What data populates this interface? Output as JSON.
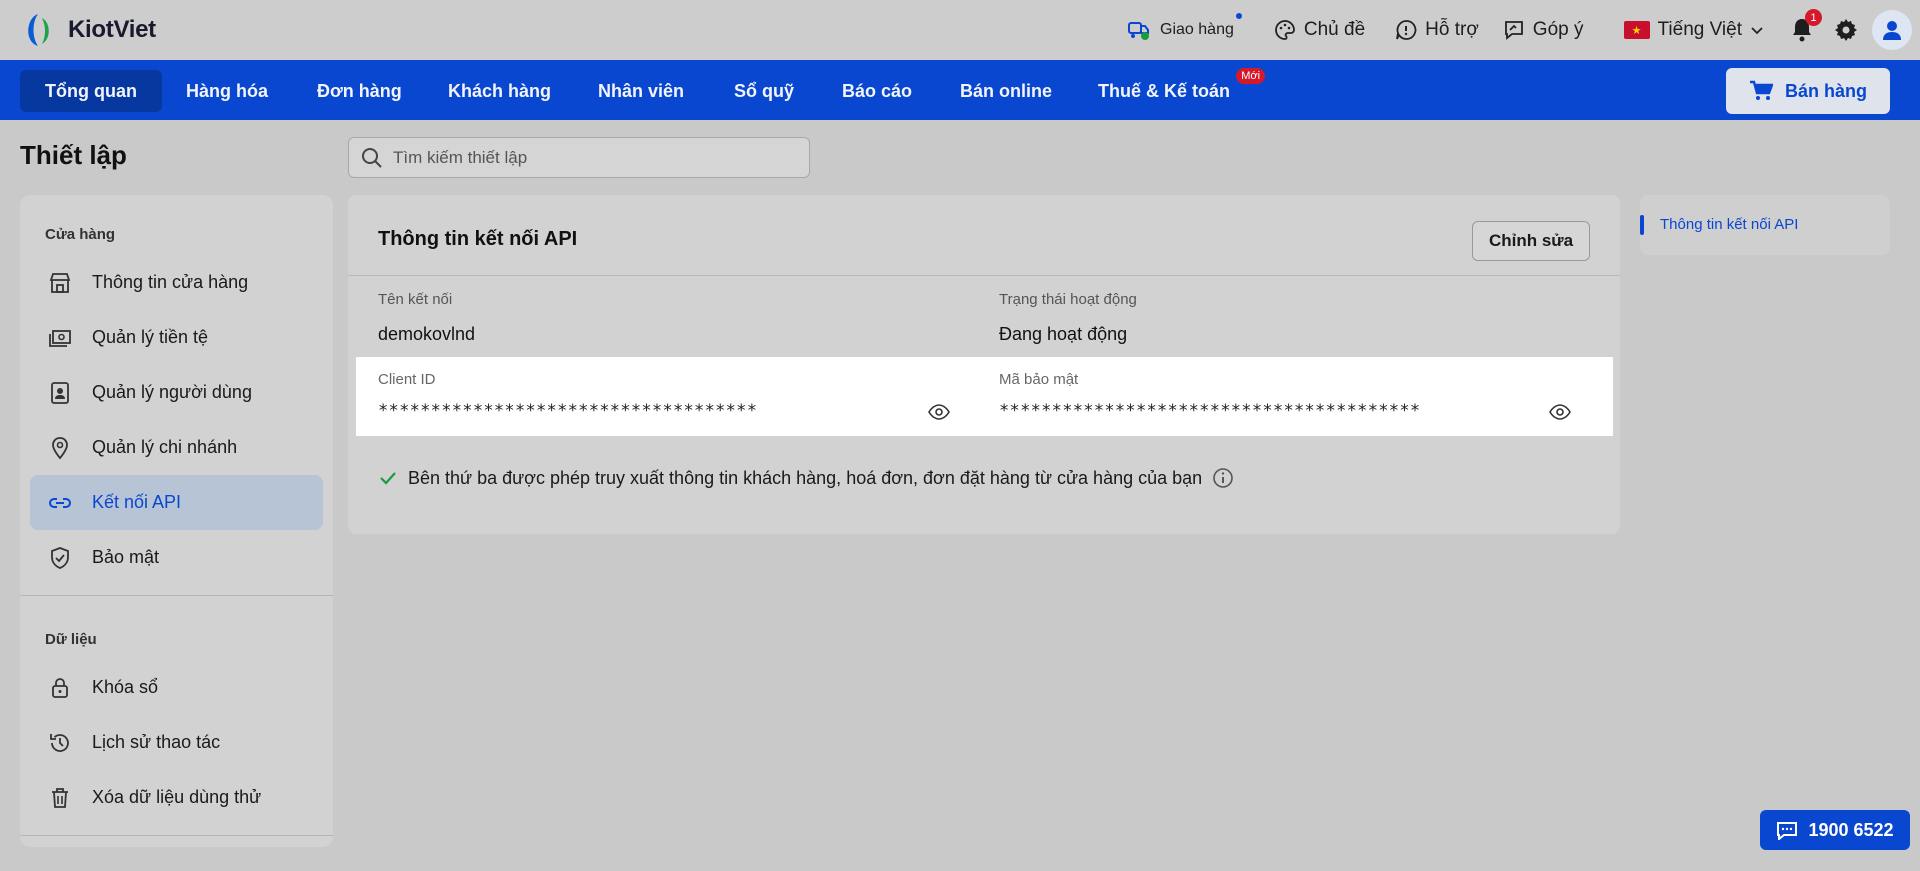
{
  "app": {
    "brand": "KiotViet",
    "colors": {
      "primary": "#0a47d1",
      "danger": "#d6182a",
      "success": "#1a9b3f"
    }
  },
  "topbar": {
    "delivery": "Giao hàng",
    "theme": "Chủ đề",
    "support": "Hỗ trợ",
    "feedback": "Góp ý",
    "language": "Tiếng Việt",
    "notification_count": "1"
  },
  "nav": {
    "items": [
      "Tổng quan",
      "Hàng hóa",
      "Đơn hàng",
      "Khách hàng",
      "Nhân viên",
      "Sổ quỹ",
      "Báo cáo",
      "Bán online",
      "Thuế & Kế toán"
    ],
    "active": "Tổng quan",
    "new_badge": "Mới",
    "sell_button": "Bán hàng"
  },
  "page": {
    "title": "Thiết lập",
    "search_placeholder": "Tìm kiếm thiết lập"
  },
  "sidebar": {
    "sections": [
      {
        "title": "Cửa hàng",
        "items": [
          "Thông tin cửa hàng",
          "Quản lý tiền tệ",
          "Quản lý người dùng",
          "Quản lý chi nhánh",
          "Kết nối API",
          "Bảo mật"
        ]
      },
      {
        "title": "Dữ liệu",
        "items": [
          "Khóa sổ",
          "Lịch sử thao tác",
          "Xóa dữ liệu dùng thử"
        ]
      }
    ],
    "active": "Kết nối API"
  },
  "card": {
    "title": "Thông tin kết nối API",
    "edit_button": "Chỉnh sửa",
    "connection_name_label": "Tên kết nối",
    "connection_name_value": "demokovlnd",
    "status_label": "Trạng thái hoạt động",
    "status_value": "Đang hoạt động",
    "client_id_label": "Client ID",
    "client_id_value": "************************************",
    "secret_label": "Mã bảo mật",
    "secret_value": "****************************************",
    "permission_note": "Bên thứ ba được phép truy xuất thông tin khách hàng, hoá đơn, đơn đặt hàng từ cửa hàng của bạn"
  },
  "anchor_nav": {
    "items": [
      "Thông tin kết nối API"
    ]
  },
  "hotline": "1900 6522"
}
